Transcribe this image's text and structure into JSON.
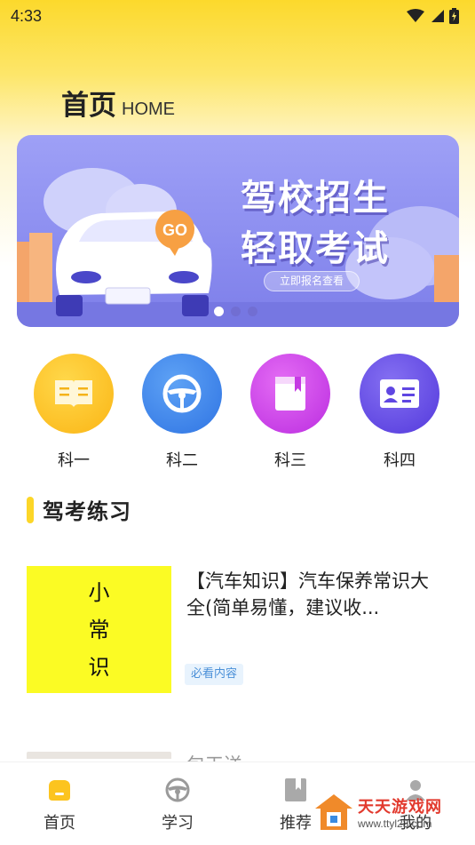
{
  "status_bar": {
    "time": "4:33"
  },
  "header": {
    "title": "首页",
    "title_en": "HOME"
  },
  "banner": {
    "title_line1": "驾校招生",
    "title_line2": "轻取考试",
    "button_label": "立即报名查看",
    "badge": "GO",
    "dot_count": 3,
    "active_dot": 0
  },
  "subjects": [
    {
      "label": "科一",
      "icon": "book-icon",
      "color": "#fcc21c"
    },
    {
      "label": "科二",
      "icon": "steering-wheel-icon",
      "color": "#3f86ec"
    },
    {
      "label": "科三",
      "icon": "notebook-icon",
      "color": "#cf45ea"
    },
    {
      "label": "科四",
      "icon": "id-card-icon",
      "color": "#6a4de8"
    }
  ],
  "section": {
    "title": "驾考练习"
  },
  "articles": [
    {
      "thumb_text": [
        "小",
        "常",
        "识"
      ],
      "title": "【汽车知识】汽车保养常识大全(简单易懂，建议收...",
      "tag": "必看内容"
    },
    {
      "title": "包天送…"
    }
  ],
  "tabbar": {
    "items": [
      {
        "label": "首页",
        "icon": "home-icon",
        "active": true
      },
      {
        "label": "学习",
        "icon": "steering-wheel-icon",
        "active": false
      },
      {
        "label": "推荐",
        "icon": "bookmark-icon",
        "active": false
      },
      {
        "label": "我的",
        "icon": "user-icon",
        "active": false
      }
    ]
  },
  "watermark": {
    "title": "天天游戏网",
    "url": "www.ttyl23.com"
  },
  "colors": {
    "accent_yellow": "#fcd628",
    "banner_purple": "#8c8ef0",
    "tag_blue": "#4b90d8"
  }
}
